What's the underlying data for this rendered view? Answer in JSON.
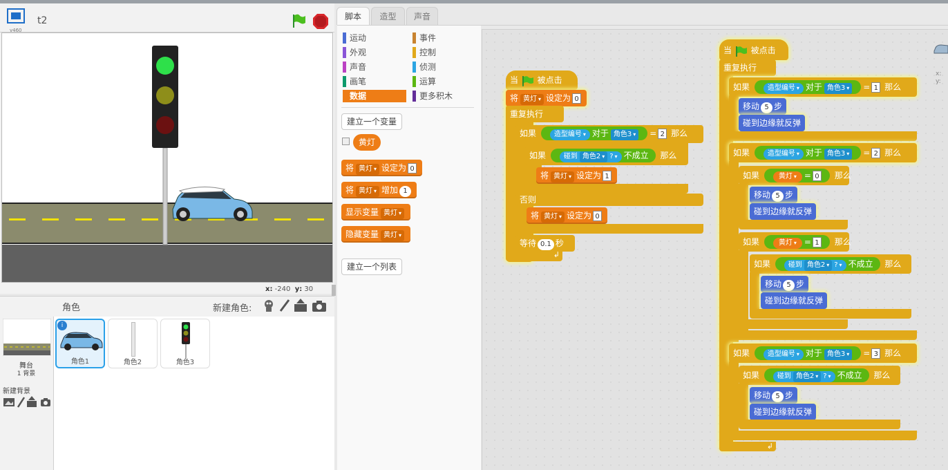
{
  "stage": {
    "project_title": "t2",
    "version": "v460",
    "coord_x_label": "x:",
    "coord_x": "-240",
    "coord_y_label": "y:",
    "coord_y": "30"
  },
  "sprites_panel": {
    "header": "角色",
    "new_sprite": "新建角色:",
    "stage_label": "舞台",
    "stage_backdrops": "1 背景",
    "new_backdrop": "新建背景",
    "sprites": [
      {
        "name": "角色1"
      },
      {
        "name": "角色2"
      },
      {
        "name": "角色3"
      }
    ]
  },
  "tabs": [
    "脚本",
    "造型",
    "声音"
  ],
  "categories_left": [
    "运动",
    "外观",
    "声音",
    "画笔",
    "数据"
  ],
  "categories_right": [
    "事件",
    "控制",
    "侦测",
    "运算",
    "更多积木"
  ],
  "palette": {
    "make_variable": "建立一个变量",
    "variable_name": "黄灯",
    "set_word": "将",
    "set_to": "设定为",
    "set_value": "0",
    "change_word": "将",
    "change_by": "增加",
    "change_value": "1",
    "show_var": "显示变量",
    "hide_var": "隐藏变量",
    "make_list": "建立一个列表"
  },
  "script1": {
    "when": "当",
    "clicked": "被点击",
    "set": "将",
    "var": "黄灯",
    "set_to": "设定为",
    "v0": "0",
    "forever": "重复执行",
    "if": "如果",
    "costume_num": "造型编号",
    "of": "对于",
    "sprite3": "角色3",
    "eq": "=",
    "n2": "2",
    "then": "那么",
    "touching": "碰到",
    "sprite2": "角色2",
    "q": "?",
    "not": "不成立",
    "v1": "1",
    "else": "否则",
    "wait": "等待",
    "wait_val": "0.1",
    "sec": "秒"
  },
  "script2": {
    "when": "当",
    "clicked": "被点击",
    "forever": "重复执行",
    "if": "如果",
    "costume_num": "造型编号",
    "of": "对于",
    "sprite3": "角色3",
    "eq": "=",
    "n1": "1",
    "n2": "2",
    "n3": "3",
    "then": "那么",
    "move": "移动",
    "steps": "步",
    "five": "5",
    "bounce": "碰到边缘就反弹",
    "yellow": "黄灯",
    "v0": "0",
    "v1": "1",
    "touching": "碰到",
    "sprite2": "角色2",
    "q": "?",
    "not": "不成立"
  },
  "colors": {
    "data": "#ee7d16",
    "control": "#e1a91a",
    "motion": "#4a6cd4",
    "sensing": "#2ca5e2",
    "operators": "#5cb712",
    "events": "#c88330"
  }
}
